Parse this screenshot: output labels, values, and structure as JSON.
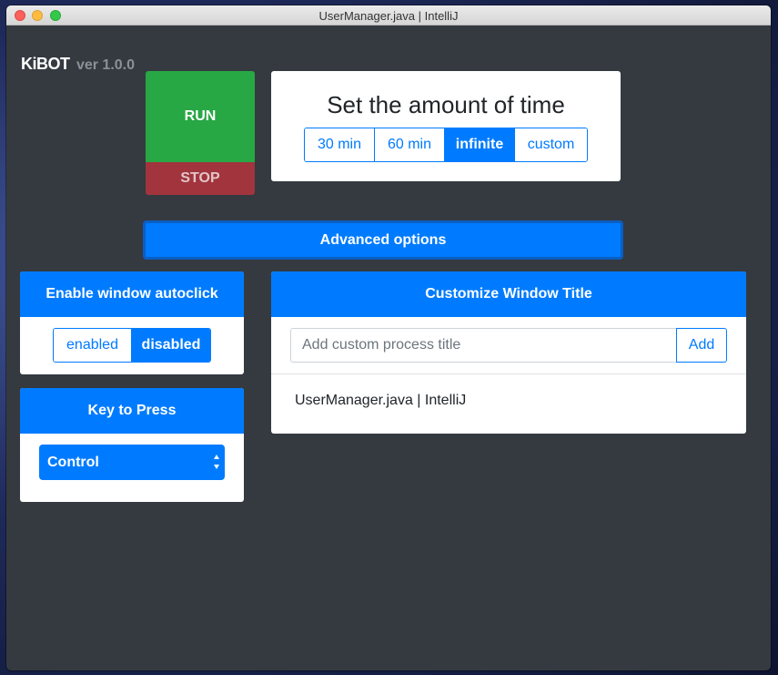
{
  "window": {
    "title": "UserManager.java | IntelliJ"
  },
  "brand": {
    "name": "KiBOT",
    "version": "ver 1.0.0"
  },
  "controls": {
    "run_label": "RUN",
    "stop_label": "STOP"
  },
  "time": {
    "title": "Set the amount of time",
    "options": [
      "30 min",
      "60 min",
      "infinite",
      "custom"
    ],
    "selected": "infinite"
  },
  "advanced": {
    "label": "Advanced options"
  },
  "autoclick": {
    "header": "Enable window autoclick",
    "options": [
      "enabled",
      "disabled"
    ],
    "selected": "disabled"
  },
  "key": {
    "header": "Key to Press",
    "selected": "Control"
  },
  "window_title": {
    "header": "Customize Window Title",
    "placeholder": "Add custom process title",
    "add_label": "Add",
    "items": [
      "UserManager.java | IntelliJ"
    ]
  },
  "colors": {
    "primary": "#007bff",
    "success": "#28a745",
    "danger": "#a1343d",
    "background": "#343a40"
  }
}
